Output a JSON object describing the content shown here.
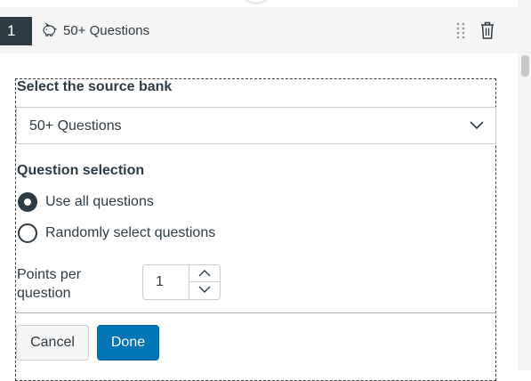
{
  "header": {
    "number": "1",
    "title": "50+ Questions",
    "bank_icon": "piggy-bank-icon",
    "drag_icon": "drag-handle-icon",
    "delete_icon": "trash-icon"
  },
  "source_bank": {
    "label": "Select the source bank",
    "selected": "50+ Questions"
  },
  "question_selection": {
    "label": "Question selection",
    "options": [
      {
        "label": "Use all questions",
        "checked": true
      },
      {
        "label": "Randomly select questions",
        "checked": false
      }
    ]
  },
  "points": {
    "label": "Points per question",
    "value": "1"
  },
  "footer": {
    "cancel_label": "Cancel",
    "done_label": "Done"
  },
  "colors": {
    "primary": "#0374b5",
    "text": "#2d3b45",
    "badge_bg": "#2d3b45"
  }
}
